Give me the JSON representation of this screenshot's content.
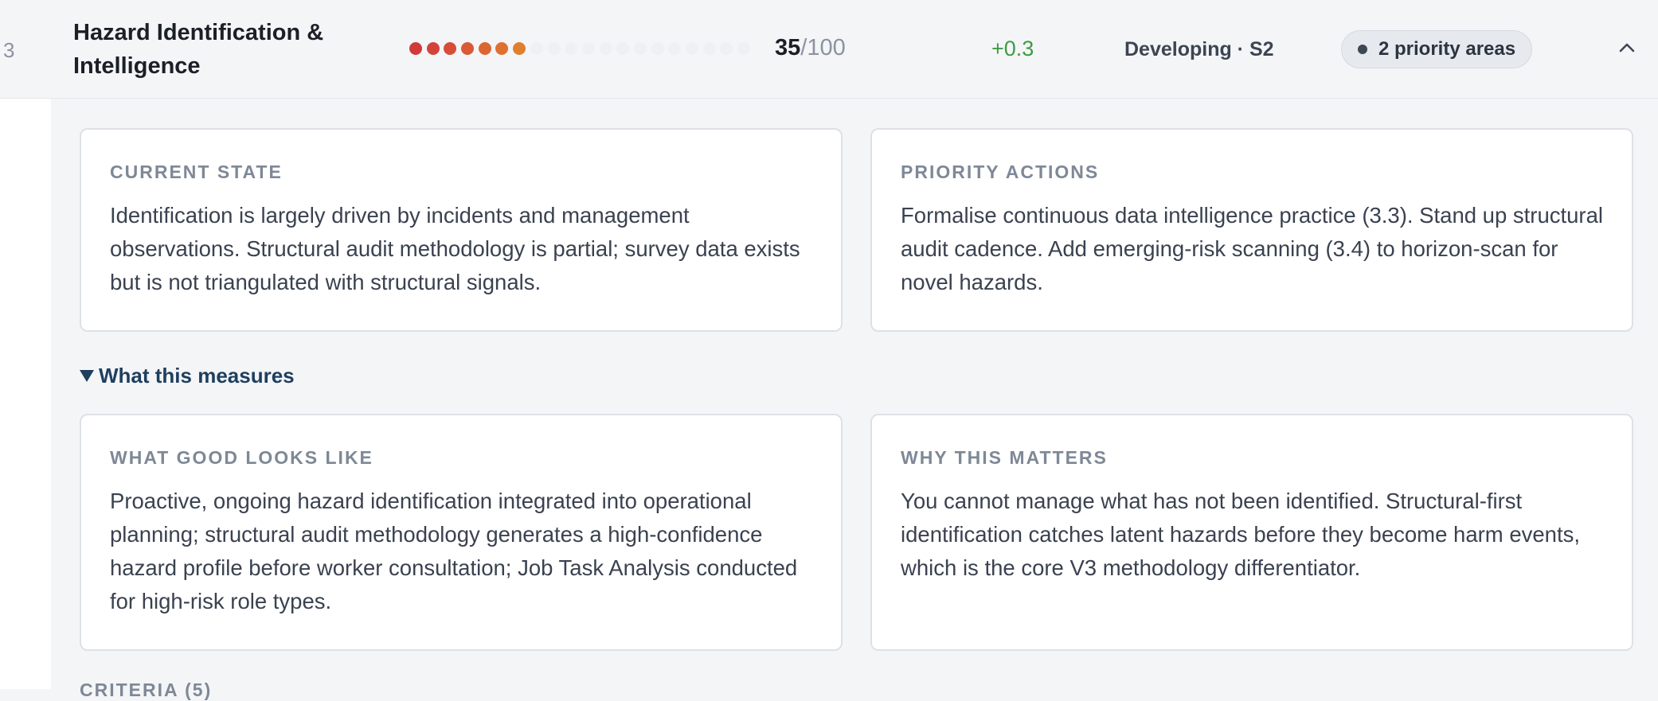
{
  "row": {
    "index": "3",
    "title": "Hazard Identification & Intelligence",
    "score_value": "35",
    "score_max": "/100",
    "delta": "+0.3",
    "stage": "Developing · S2",
    "priority_label": "2 priority areas",
    "progress_fraction": 0.35,
    "dot_colors": [
      "#d13a3a",
      "#d3433a",
      "#d64d38",
      "#d95a35",
      "#dc6632",
      "#de7130",
      "#e17f2e"
    ],
    "dot_empty_color": "#eef0f3",
    "dot_count": 20,
    "delta_color": "#3f9b43"
  },
  "detail": {
    "current_state": {
      "heading": "CURRENT STATE",
      "body": "Identification is largely driven by incidents and management observations. Structural audit methodology is partial; survey data exists but is not triangulated with structural signals."
    },
    "priority_actions": {
      "heading": "PRIORITY ACTIONS",
      "body": "Formalise continuous data intelligence practice (3.3). Stand up structural audit cadence. Add emerging-risk scanning (3.4) to horizon-scan for novel hazards."
    },
    "measures_toggle_label": "What this measures",
    "what_good": {
      "heading": "WHAT GOOD LOOKS LIKE",
      "body": "Proactive, ongoing hazard identification integrated into operational planning; structural audit methodology generates a high-confidence hazard profile before worker consultation; Job Task Analysis conducted for high-risk role types."
    },
    "why_matters": {
      "heading": "WHY THIS MATTERS",
      "body": "You cannot manage what has not been identified. Structural-first identification catches latent hazards before they become harm events, which is the core V3 methodology differentiator."
    },
    "criteria_label": "CRITERIA (5)"
  },
  "icons": {
    "collapse": "chevron-up-icon",
    "toggle": "triangle-down-icon",
    "pill": "dot-icon"
  }
}
